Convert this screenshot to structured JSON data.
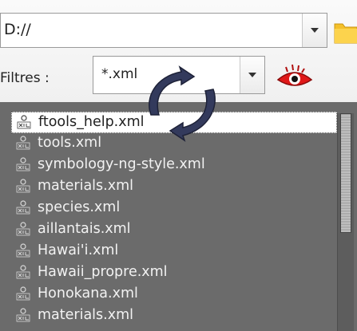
{
  "path": {
    "value": "D://"
  },
  "filter": {
    "label": "Filtres :",
    "value": "*.xml"
  },
  "icons": {
    "folder": "folder-icon",
    "eye": "eye-icon",
    "refresh": "refresh-icon",
    "file": "xml-file-icon"
  },
  "colors": {
    "list_background": "#6b6b6b",
    "folder": "#f4c02a",
    "eye_red": "#e01818",
    "refresh_arrows": "#333a5c"
  },
  "files": [
    {
      "name": "ftools_help.xml",
      "selected": true
    },
    {
      "name": "tools.xml"
    },
    {
      "name": "symbology-ng-style.xml"
    },
    {
      "name": "materials.xml"
    },
    {
      "name": "species.xml"
    },
    {
      "name": "aillantais.xml"
    },
    {
      "name": "Hawai'i.xml"
    },
    {
      "name": "Hawaii_propre.xml"
    },
    {
      "name": "Honokana.xml"
    },
    {
      "name": "materials.xml"
    }
  ]
}
